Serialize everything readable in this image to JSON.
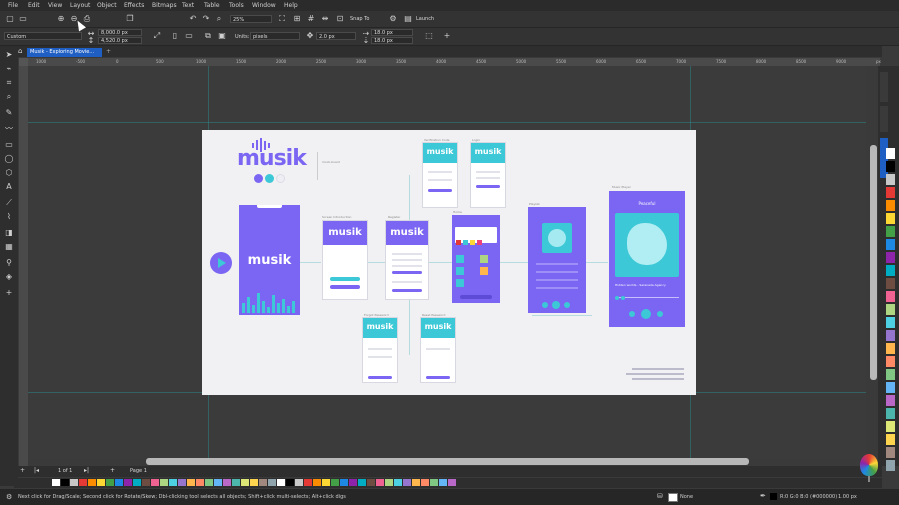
{
  "menu": [
    "File",
    "Edit",
    "View",
    "Layout",
    "Object",
    "Effects",
    "Bitmaps",
    "Text",
    "Table",
    "Tools",
    "Window",
    "Help"
  ],
  "toolbar": {
    "zoom": "25%",
    "snap": "Snap To",
    "launch": "Launch"
  },
  "propbar": {
    "preset": "Custom",
    "width": "8,000.0 px",
    "height": "4,520.0 px",
    "units_label": "Units:",
    "units": "pixels",
    "nudge": "2.0 px",
    "dup_x": "18.0 px",
    "dup_y": "18.0 px"
  },
  "document": {
    "tab_title": "Musik - Exploring Movie..."
  },
  "ruler": {
    "ticks": [
      "1000",
      "-500",
      "0",
      "500",
      "1000",
      "1500",
      "2000",
      "2500",
      "3000",
      "3500",
      "4000",
      "4500",
      "5000",
      "5500",
      "6000",
      "6500",
      "7000",
      "7500",
      "8000",
      "8500",
      "9000",
      "px"
    ]
  },
  "canvas": {
    "brand": "musik",
    "brand_caption": "mock-board",
    "splash_brand": "musik",
    "screens": [
      {
        "caption": "Screen Introduction",
        "brand": "musik"
      },
      {
        "caption": "Register",
        "brand": "musik"
      },
      {
        "caption": "Verification Code",
        "brand": "musik"
      },
      {
        "caption": "Login",
        "brand": "musik"
      },
      {
        "caption": "Forgot Password",
        "brand": "musik"
      },
      {
        "caption": "Reset Password",
        "brand": "musik"
      },
      {
        "caption": "Home",
        "brand": ""
      },
      {
        "caption": "Playlist",
        "brand": ""
      },
      {
        "caption": "Music Player",
        "brand": ""
      }
    ],
    "player_title": "Peaceful",
    "player_song": "Hidden worlds - Serenade Agency"
  },
  "pagebar": {
    "page_count": "1 of 1",
    "page_tab": "Page 1"
  },
  "palette_colors": [
    "#ffffff",
    "#000000",
    "#c8c8c8",
    "#e53935",
    "#fb8c00",
    "#fdd835",
    "#43a047",
    "#1e88e5",
    "#8e24aa",
    "#00acc1",
    "#6d4c41",
    "#f06292",
    "#aed581",
    "#4dd0e1",
    "#9575cd",
    "#ffb74d",
    "#ff8a65",
    "#81c784",
    "#64b5f6",
    "#ba68c8",
    "#4db6ac",
    "#dce775",
    "#ffd54f",
    "#a1887f",
    "#90a4ae"
  ],
  "status": {
    "hint": "Next click for Drag/Scale; Second click for Rotate/Skew; Dbl-clicking tool selects all objects; Shift+click multi-selects; Alt+click digs",
    "fill": "None",
    "outline": "R:0 G:0 B:0 (#000000)",
    "outline_width": "1.00 px"
  },
  "colors": {
    "accent": "#1f5fc4",
    "brand_purple": "#7a66f2",
    "brand_teal": "#3cc8d6"
  }
}
